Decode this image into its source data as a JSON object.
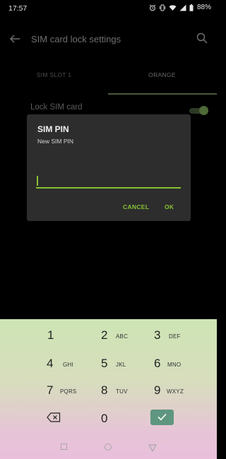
{
  "status_bar": {
    "time": "17:57",
    "battery": "88%",
    "icons": [
      "alarm-icon",
      "vibrate-icon",
      "wifi-icon",
      "signal-icon",
      "battery-icon"
    ]
  },
  "header": {
    "title": "SIM card lock settings",
    "back_icon": "arrow-left-icon",
    "search_icon": "search-icon"
  },
  "tabs": [
    {
      "label": "SIM SLOT 1"
    },
    {
      "label": "ORANGE",
      "selected": true
    }
  ],
  "settings": {
    "lock_sim_label": "Lock SIM card",
    "lock_sim_enabled": true
  },
  "dialog": {
    "title": "SIM PIN",
    "subtitle": "New SIM PIN",
    "input_value": "",
    "cancel_label": "CANCEL",
    "ok_label": "OK"
  },
  "keypad": {
    "keys": [
      {
        "digit": "1",
        "letters": ""
      },
      {
        "digit": "2",
        "letters": "ABC"
      },
      {
        "digit": "3",
        "letters": "DEF"
      },
      {
        "digit": "4",
        "letters": "GHI"
      },
      {
        "digit": "5",
        "letters": "JKL"
      },
      {
        "digit": "6",
        "letters": "MNO"
      },
      {
        "digit": "7",
        "letters": "PQRS"
      },
      {
        "digit": "8",
        "letters": "TUV"
      },
      {
        "digit": "9",
        "letters": "WXYZ"
      },
      {
        "digit": "0",
        "letters": ""
      }
    ],
    "backspace_icon": "backspace-icon",
    "done_icon": "checkmark-icon"
  },
  "nav_bar": {
    "icons": [
      "recents-square-icon",
      "home-circle-icon",
      "back-triangle-icon"
    ]
  },
  "colors": {
    "accent": "#86c232",
    "dialog_bg": "#2d2d2d",
    "done_key": "#5e9680"
  }
}
